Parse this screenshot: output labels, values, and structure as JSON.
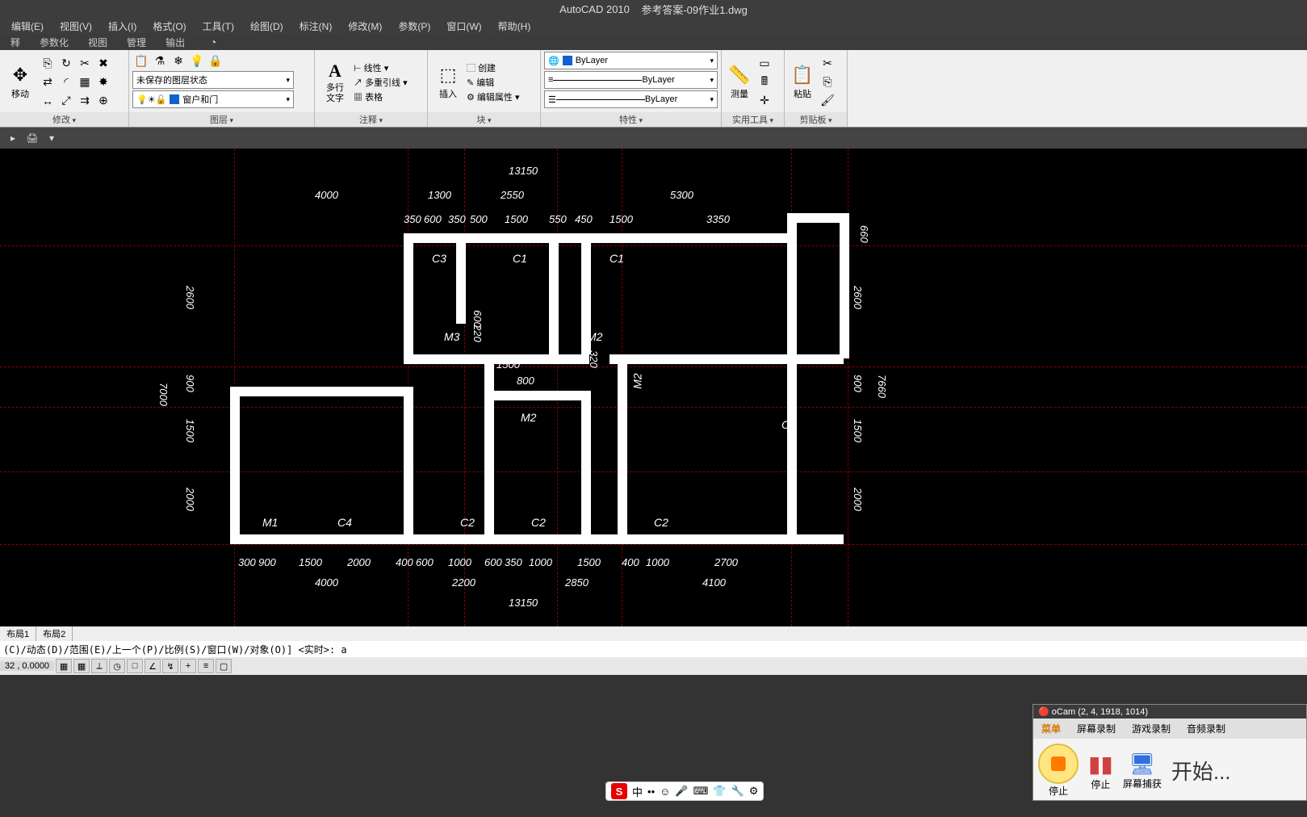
{
  "title": {
    "app": "AutoCAD 2010",
    "file": "参考答案-09作业1.dwg"
  },
  "menus": [
    "编辑(E)",
    "视图(V)",
    "插入(I)",
    "格式(O)",
    "工具(T)",
    "绘图(D)",
    "标注(N)",
    "修改(M)",
    "参数(P)",
    "窗口(W)",
    "帮助(H)"
  ],
  "tabs": [
    "释",
    "参数化",
    "视图",
    "管理",
    "输出"
  ],
  "ribbon": {
    "modify": {
      "label": "修改",
      "move": "移动"
    },
    "layer": {
      "label": "图层",
      "state": "未保存的图层状态",
      "current": "窗户和门"
    },
    "anno": {
      "label": "注释",
      "mtext": "多行\n文字",
      "linear": "线性",
      "mleader": "多重引线",
      "table": "表格"
    },
    "block": {
      "label": "块",
      "insert": "插入",
      "create": "创建",
      "edit": "编辑",
      "editattr": "编辑属性"
    },
    "props": {
      "label": "特性",
      "bylayer": "ByLayer"
    },
    "util": {
      "label": "实用工具",
      "measure": "测量"
    },
    "clip": {
      "label": "剪贴板",
      "paste": "粘贴"
    }
  },
  "drawing": {
    "dims_top_outer": "13150",
    "dims_top_mid": [
      "4000",
      "1300",
      "2550",
      "5300"
    ],
    "dims_top_inner": [
      "350",
      "600",
      "350",
      "500",
      "1500",
      "550",
      "450",
      "1500",
      "3350"
    ],
    "dims_top_right": "660",
    "dims_bottom_outer": "13150",
    "dims_bottom_mid": [
      "4000",
      "2200",
      "2850",
      "4100"
    ],
    "dims_bottom_inner": [
      "300",
      "900",
      "1500",
      "2000",
      "400",
      "600",
      "1000",
      "600",
      "350",
      "1000",
      "1500",
      "400",
      "1000",
      "2700"
    ],
    "dims_left_outer": "7000",
    "dims_left_inner": [
      "2600",
      "900",
      "1500",
      "2000"
    ],
    "dims_right_outer": "7660",
    "dims_right_inner": [
      "2600",
      "900",
      "1500",
      "2000"
    ],
    "dims_mid": {
      "v220": "220",
      "v600": "600",
      "h1500": "1500",
      "h800": "800",
      "v320": "320"
    },
    "labels": {
      "c3": "C3",
      "c1a": "C1",
      "c1b": "C1",
      "c1c": "C1",
      "m3": "M3",
      "m2a": "M2",
      "m2b": "M2",
      "m2c": "M2",
      "m1": "M1",
      "c4": "C4",
      "c2a": "C2",
      "c2b": "C2",
      "c2c": "C2"
    }
  },
  "layout_tabs": [
    "布局1",
    "布局2"
  ],
  "cmd": "(C)/动态(D)/范围(E)/上一个(P)/比例(S)/窗口(W)/对象(O)] <实时>: a",
  "status": {
    "coords": "32 , 0.0000"
  },
  "ocam": {
    "title": "oCam (2, 4, 1918, 1014)",
    "tabs": [
      "菜单",
      "屏幕录制",
      "游戏录制",
      "音频录制"
    ],
    "stop": "停止",
    "pause": "停止",
    "capture": "屏幕捕获",
    "start": "开始..."
  },
  "ime": {
    "ch": "中"
  }
}
